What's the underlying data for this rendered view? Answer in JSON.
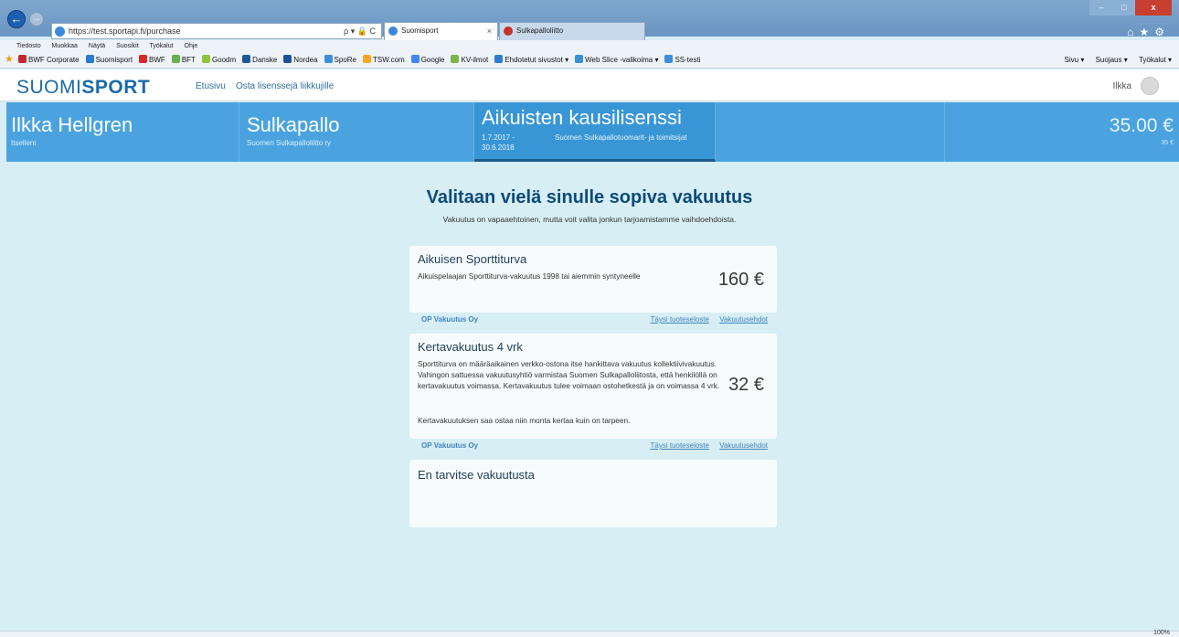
{
  "browser": {
    "url": "https://test.sportapi.fi/purchase",
    "url_tools": "ρ ▾ 🔒 C",
    "tabs": [
      {
        "label": "Suomisport",
        "active": true,
        "close": "×"
      },
      {
        "label": "Sulkapalloliitto",
        "active": false
      }
    ],
    "window_controls": {
      "minimize": "–",
      "maximize": "□",
      "close": "x"
    },
    "menu": [
      "Tiedosto",
      "Muokkaa",
      "Näytä",
      "Suosikit",
      "Työkalut",
      "Ohje"
    ],
    "favorites": [
      {
        "label": "BWF Corporate",
        "color": "#c1272d"
      },
      {
        "label": "Suomisport",
        "color": "#2b7bd1"
      },
      {
        "label": "BWF",
        "color": "#d9262c"
      },
      {
        "label": "BFT",
        "color": "#6ab04c"
      },
      {
        "label": "Goodm",
        "color": "#8fc33a"
      },
      {
        "label": "Danske",
        "color": "#1d5a95"
      },
      {
        "label": "Nordea",
        "color": "#1e4f9c"
      },
      {
        "label": "SpoRe",
        "color": "#3a8fd9"
      },
      {
        "label": "TSW.com",
        "color": "#f5a623"
      },
      {
        "label": "Google",
        "color": "#4285f4"
      },
      {
        "label": "KV-ilmot",
        "color": "#7ab648"
      },
      {
        "label": "Ehdotetut sivustot ▾",
        "color": "#2e7dd1"
      },
      {
        "label": "Web Slice -valikoima ▾",
        "color": "#3a8fd9"
      },
      {
        "label": "SS-testi",
        "color": "#3a8fd9"
      }
    ],
    "fav_right": [
      "Sivu ▾",
      "Suojaus ▾",
      "Työkalut ▾"
    ],
    "zoom": "100%"
  },
  "header": {
    "logo_light": "SUOMI",
    "logo_bold": "SPORT",
    "nav": {
      "home": "Etusivu",
      "buy": "Osta lisenssejä liikkujille"
    },
    "user": "Ilkka"
  },
  "summary": {
    "person": {
      "name": "Ilkka Hellgren",
      "sub": "Itselleni"
    },
    "sport": {
      "name": "Sulkapallo",
      "org": "Suomen Sulkapalloliitto ry"
    },
    "license": {
      "name": "Aikuisten kausilisenssi",
      "dates": "1.7.2017 - 30.6.2018",
      "org": "Suomen Sulkapallotuomarit- ja toimitsijat"
    },
    "total": {
      "price": "35.00 €",
      "sub": "35 €"
    }
  },
  "main": {
    "title": "Valitaan vielä sinulle sopiva vakuutus",
    "subtitle": "Vakuutus on vapaaehtoinen, mutta voit valita jonkun tarjoamistamme vaihdoehdoista."
  },
  "insurances": [
    {
      "title": "Aikuisen Sporttiturva",
      "desc": "Aikuispelaajan Sporttiturva-vakuutus 1998 tai aiemmin syntyneelle",
      "price": "160 €",
      "provider": "OP Vakuutus Oy",
      "link_product": "Täysi tuoteseloste",
      "link_terms": "Vakuutusehdot"
    },
    {
      "title": "Kertavakuutus 4 vrk",
      "desc": "Sporttiturva on määräaikainen verkko-ostona itse hankittava vakuutus kollektiivivakuutus. Vahingon sattuessa vakuutusyhtiö varmistaa Suomen Sulkapalloliitosta, että henkilöllä on kertavakuutus voimassa. Kertavakuutus tulee voimaan ostohetkestä ja on voimassa 4 vrk.",
      "desc2": "Kertavakuutuksen saa ostaa niin monta kertaa kuin on tarpeen.",
      "price": "32 €",
      "provider": "OP Vakuutus Oy",
      "link_product": "Täysi tuoteseloste",
      "link_terms": "Vakuutusehdot"
    },
    {
      "title": "En tarvitse vakuutusta"
    }
  ]
}
